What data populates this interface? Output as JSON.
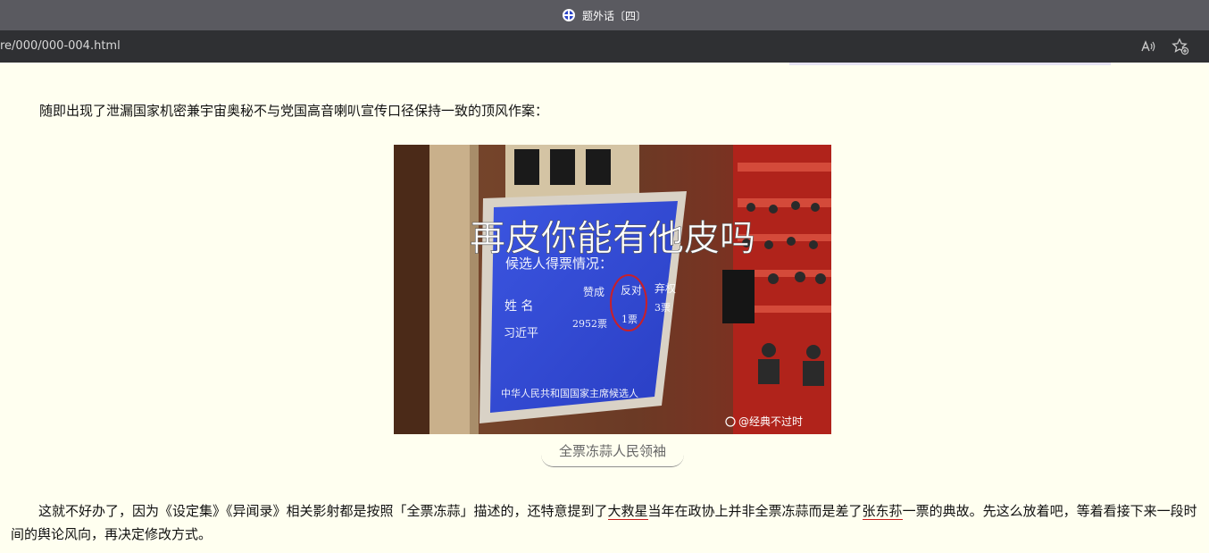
{
  "window": {
    "title": "题外话〔四〕"
  },
  "addressbar": {
    "url": "re/000/000-004.html"
  },
  "article": {
    "para1": "随即出现了泄漏国家机密兼宇宙奥秘不与党国高音喇叭宣传口径保持一致的顶风作案：",
    "image": {
      "overlay_text": "再皮你能有他皮吗",
      "board_lines": [
        "候选人得票情况：",
        "赞成",
        "反对",
        "弃权",
        "姓 名",
        "习近平",
        "2952票",
        "1票",
        "3票",
        "中华人民共和国国家主席候选人"
      ],
      "watermark": "@经典不过时"
    },
    "caption": "全票冻蒜人民领袖",
    "para2": {
      "seg1": "这就不好办了，因为《设定集》《异闻录》相关影射都是按照「全票冻蒜」描述的，还特意提到了",
      "link1": "大救星",
      "seg2": "当年在政协上并非全票冻蒜而是差了",
      "link2": "张东荪",
      "seg3": "一票的典故。先这么放着吧，等着看接下来一段时间的舆论风向，再决定修改方式。"
    }
  },
  "icons": [
    "site-favicon-icon",
    "read-aloud-icon",
    "add-favorite-icon"
  ]
}
